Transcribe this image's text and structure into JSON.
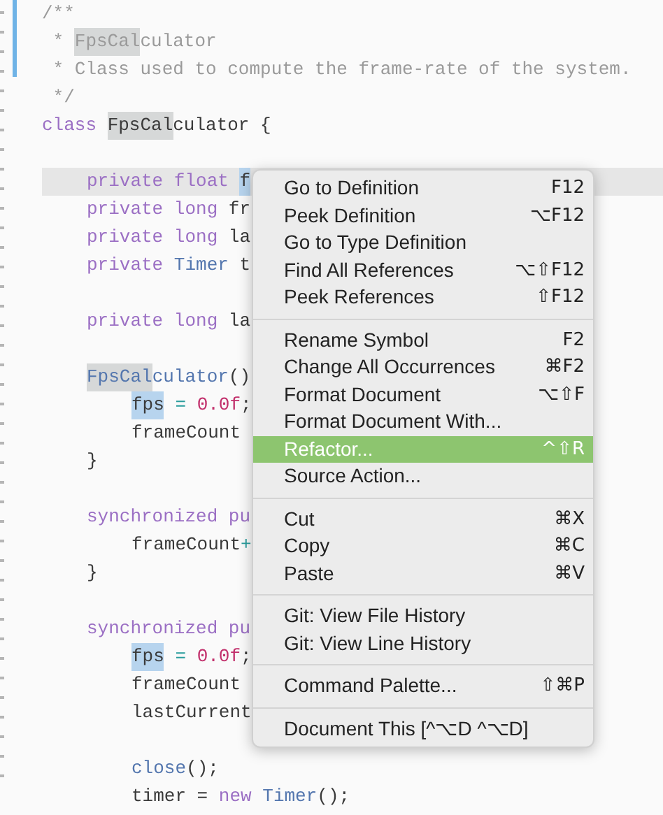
{
  "code": [
    {
      "kind": "code",
      "current": false,
      "segments": [
        {
          "text": "/**",
          "kind": "comment"
        }
      ]
    },
    {
      "kind": "code",
      "current": false,
      "segments": [
        {
          "text": " * ",
          "kind": "comment"
        },
        {
          "text": "FpsCal",
          "kind": "comment",
          "color": "#d6d8d8"
        },
        {
          "text": "culator",
          "kind": "comment"
        }
      ]
    },
    {
      "kind": "code",
      "current": false,
      "segments": [
        {
          "text": " * Class used to compute the frame-rate of the system.",
          "kind": "comment"
        }
      ]
    },
    {
      "kind": "code",
      "current": false,
      "segments": [
        {
          "text": " */",
          "kind": "comment"
        }
      ]
    },
    {
      "kind": "code",
      "current": false,
      "segments": [
        {
          "text": "class ",
          "kind": "keyword"
        },
        {
          "text": "FpsCal",
          "kind": "plain",
          "color": "#d6d8d8"
        },
        {
          "text": "culator {",
          "kind": "plain"
        }
      ],
      "children": [
        {
          "kind": "blank",
          "current": false
        },
        {
          "kind": "code",
          "current": true,
          "segments": [
            {
              "text": "private float ",
              "kind": "keyword"
            },
            {
              "text": "f",
              "kind": "plain",
              "color": "#b7d4ee"
            }
          ]
        },
        {
          "kind": "code",
          "current": false,
          "segments": [
            {
              "text": "private long ",
              "kind": "keyword"
            },
            {
              "text": "fr",
              "kind": "plain"
            }
          ]
        },
        {
          "kind": "code",
          "current": false,
          "segments": [
            {
              "text": "private long ",
              "kind": "keyword"
            },
            {
              "text": "la",
              "kind": "plain"
            }
          ]
        },
        {
          "kind": "code",
          "current": false,
          "segments": [
            {
              "text": "private ",
              "kind": "keyword"
            },
            {
              "text": "Timer ",
              "kind": "type"
            },
            {
              "text": "t",
              "kind": "plain"
            }
          ]
        },
        {
          "kind": "blank",
          "current": false
        },
        {
          "kind": "code",
          "current": false,
          "segments": [
            {
              "text": "private long ",
              "kind": "keyword"
            },
            {
              "text": "la",
              "kind": "plain"
            }
          ]
        },
        {
          "kind": "blank",
          "current": false
        },
        {
          "kind": "code",
          "current": false,
          "segments": [
            {
              "text": "FpsCal",
              "kind": "type",
              "color": "#d6d8d8"
            },
            {
              "text": "culator",
              "kind": "type"
            },
            {
              "text": "()",
              "kind": "plain"
            }
          ],
          "children": [
            {
              "kind": "code",
              "current": false,
              "segments": [
                {
                  "text": "fps",
                  "kind": "plain",
                  "color": "#b7d4ee"
                },
                {
                  "text": " = ",
                  "kind": "operator"
                },
                {
                  "text": "0.0f",
                  "kind": "number"
                },
                {
                  "text": ";",
                  "kind": "plain"
                }
              ]
            },
            {
              "kind": "code",
              "current": false,
              "segments": [
                {
                  "text": "frameCount",
                  "kind": "plain"
                }
              ]
            }
          ]
        },
        {
          "kind": "code",
          "current": false,
          "segments": [
            {
              "text": "}",
              "kind": "plain"
            }
          ]
        },
        {
          "kind": "blank",
          "current": false
        },
        {
          "kind": "code",
          "current": false,
          "segments": [
            {
              "text": "synchronized pu",
              "kind": "keyword"
            }
          ],
          "children": [
            {
              "kind": "code",
              "current": false,
              "segments": [
                {
                  "text": "frameCount",
                  "kind": "plain"
                },
                {
                  "text": "+",
                  "kind": "operator"
                }
              ]
            }
          ]
        },
        {
          "kind": "code",
          "current": false,
          "segments": [
            {
              "text": "}",
              "kind": "plain"
            }
          ]
        },
        {
          "kind": "blank",
          "current": false
        },
        {
          "kind": "code",
          "current": false,
          "segments": [
            {
              "text": "synchronized pu",
              "kind": "keyword"
            }
          ],
          "children": [
            {
              "kind": "code",
              "current": false,
              "segments": [
                {
                  "text": "fps",
                  "kind": "plain",
                  "color": "#b7d4ee"
                },
                {
                  "text": " = ",
                  "kind": "operator"
                },
                {
                  "text": "0.0f",
                  "kind": "number"
                },
                {
                  "text": ";",
                  "kind": "plain"
                }
              ]
            },
            {
              "kind": "code",
              "current": false,
              "segments": [
                {
                  "text": "frameCount",
                  "kind": "plain"
                }
              ]
            },
            {
              "kind": "code",
              "current": false,
              "segments": [
                {
                  "text": "lastCurrent",
                  "kind": "plain"
                }
              ]
            },
            {
              "kind": "blank",
              "current": false
            },
            {
              "kind": "code",
              "current": false,
              "segments": [
                {
                  "text": "close",
                  "kind": "type"
                },
                {
                  "text": "();",
                  "kind": "plain"
                }
              ]
            },
            {
              "kind": "code",
              "current": false,
              "segments": [
                {
                  "text": "timer = ",
                  "kind": "plain"
                },
                {
                  "text": "new ",
                  "kind": "keyword"
                },
                {
                  "text": "Timer",
                  "kind": "type"
                },
                {
                  "text": "();",
                  "kind": "plain"
                }
              ]
            }
          ]
        }
      ]
    }
  ],
  "context_menu": {
    "groups": [
      {
        "items": [
          {
            "label": "Go to Definition",
            "shortcut": "F12",
            "selected": false
          },
          {
            "label": "Peek Definition",
            "shortcut": "⌥F12",
            "selected": false
          },
          {
            "label": "Go to Type Definition",
            "selected": false
          },
          {
            "label": "Find All References",
            "shortcut": "⌥⇧F12",
            "selected": false
          },
          {
            "label": "Peek References",
            "shortcut": "⇧F12",
            "selected": false
          }
        ]
      },
      {
        "items": [
          {
            "label": "Rename Symbol",
            "shortcut": "F2",
            "selected": false
          },
          {
            "label": "Change All Occurrences",
            "shortcut": "⌘F2",
            "selected": false
          },
          {
            "label": "Format Document",
            "shortcut": "⌥⇧F",
            "selected": false
          },
          {
            "label": "Format Document With...",
            "selected": false
          },
          {
            "label": "Refactor...",
            "shortcut": "^⇧R",
            "selected": true
          },
          {
            "label": "Source Action...",
            "selected": false
          }
        ]
      },
      {
        "items": [
          {
            "label": "Cut",
            "shortcut": "⌘X",
            "selected": false
          },
          {
            "label": "Copy",
            "shortcut": "⌘C",
            "selected": false
          },
          {
            "label": "Paste",
            "shortcut": "⌘V",
            "selected": false
          }
        ]
      },
      {
        "items": [
          {
            "label": "Git: View File History",
            "selected": false
          },
          {
            "label": "Git: View Line History",
            "selected": false
          }
        ]
      },
      {
        "items": [
          {
            "label": "Command Palette...",
            "shortcut": "⇧⌘P",
            "selected": false
          }
        ]
      },
      {
        "items": [
          {
            "label": "Document This [^⌥D ^⌥D]",
            "selected": false
          }
        ]
      }
    ]
  }
}
